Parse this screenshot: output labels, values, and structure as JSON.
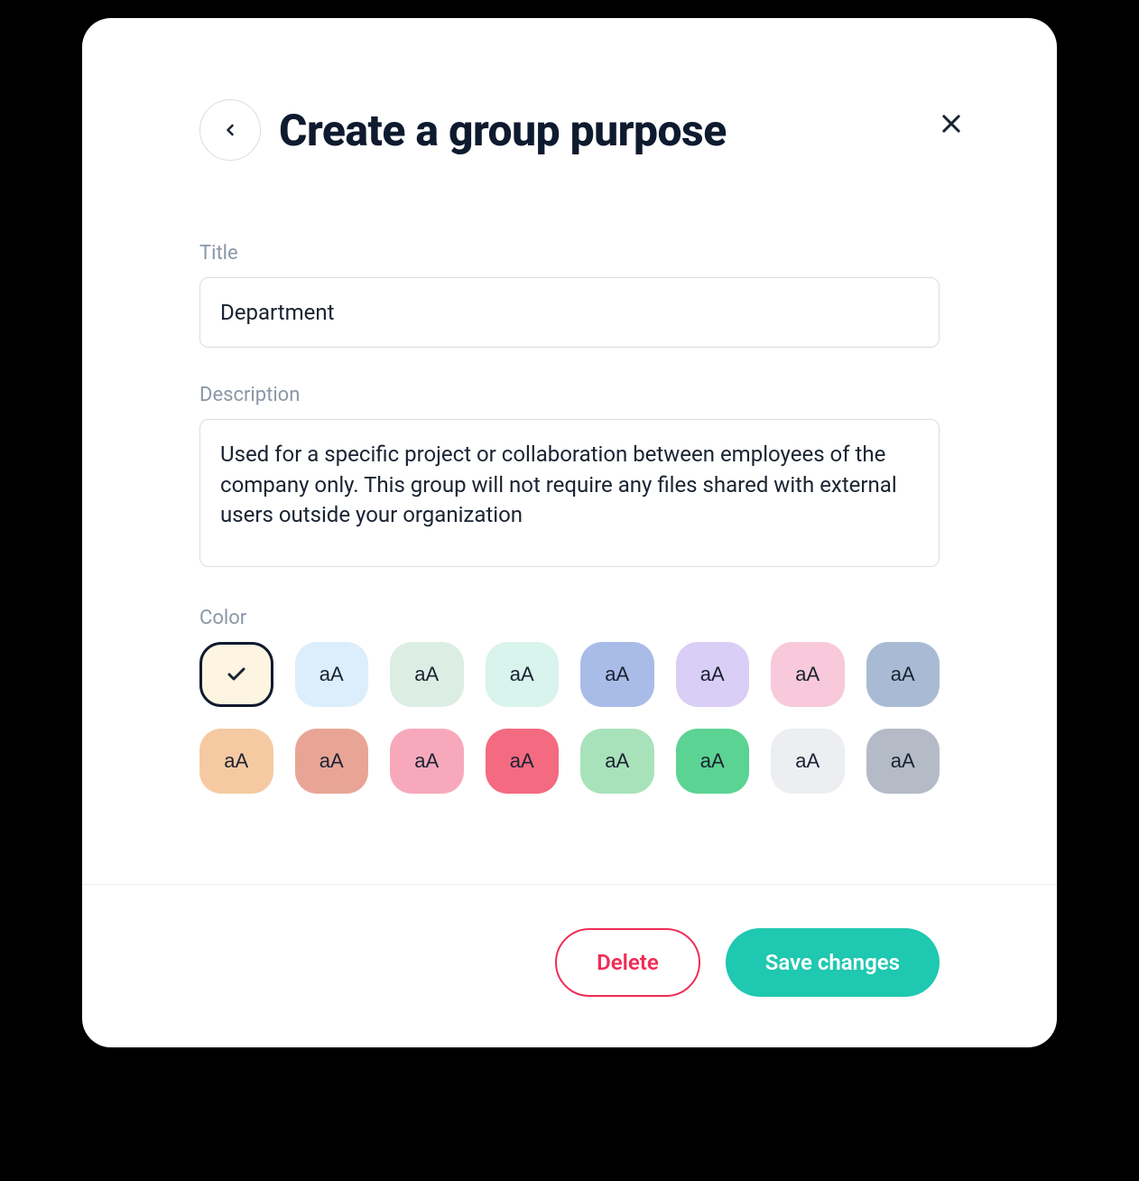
{
  "modal": {
    "title": "Create a group purpose",
    "fields": {
      "title": {
        "label": "Title",
        "value": "Department"
      },
      "description": {
        "label": "Description",
        "value": "Used for a specific project or collaboration between employees of the company only. This group will not require any files shared with external users outside your organization"
      },
      "color": {
        "label": "Color",
        "swatch_label": "aA",
        "options": [
          {
            "hex": "#fdf4e1",
            "selected": true
          },
          {
            "hex": "#dceefb",
            "selected": false
          },
          {
            "hex": "#dceee4",
            "selected": false
          },
          {
            "hex": "#d9f3ed",
            "selected": false
          },
          {
            "hex": "#a9bce8",
            "selected": false
          },
          {
            "hex": "#d9cef5",
            "selected": false
          },
          {
            "hex": "#f7c9da",
            "selected": false
          },
          {
            "hex": "#a9bbd4",
            "selected": false
          },
          {
            "hex": "#f5caa3",
            "selected": false
          },
          {
            "hex": "#e8a596",
            "selected": false
          },
          {
            "hex": "#f7a9bb",
            "selected": false
          },
          {
            "hex": "#f46a80",
            "selected": false
          },
          {
            "hex": "#a8e2ba",
            "selected": false
          },
          {
            "hex": "#5bd392",
            "selected": false
          },
          {
            "hex": "#eceef2",
            "selected": false
          },
          {
            "hex": "#b4bbc6",
            "selected": false
          }
        ]
      }
    },
    "actions": {
      "delete": "Delete",
      "save": "Save changes"
    }
  }
}
